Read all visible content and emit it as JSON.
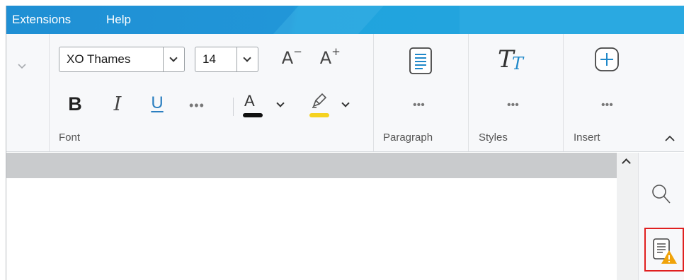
{
  "menu": {
    "items": [
      "Extensions",
      "Help"
    ]
  },
  "font_group": {
    "font_name": "XO Thames",
    "font_size": "14",
    "grow_label": "A",
    "grow_mark": "+",
    "shrink_label": "A",
    "shrink_mark": "−",
    "bold": "B",
    "italic": "I",
    "underline": "U",
    "more": "•••",
    "font_color_label": "A",
    "font_color": "#111111",
    "highlight_color": "#f5d21f",
    "label": "Font"
  },
  "paragraph_group": {
    "more": "•••",
    "label": "Paragraph"
  },
  "styles_group": {
    "icon_text": "T",
    "icon_text2": "T",
    "more": "•••",
    "label": "Styles"
  },
  "insert_group": {
    "more": "•••",
    "label": "Insert"
  },
  "colors": {
    "menubar": "#2196d8",
    "accent_blue": "#1f88c9",
    "warning": "#f0a30a",
    "highlight_box": "#e02020"
  }
}
